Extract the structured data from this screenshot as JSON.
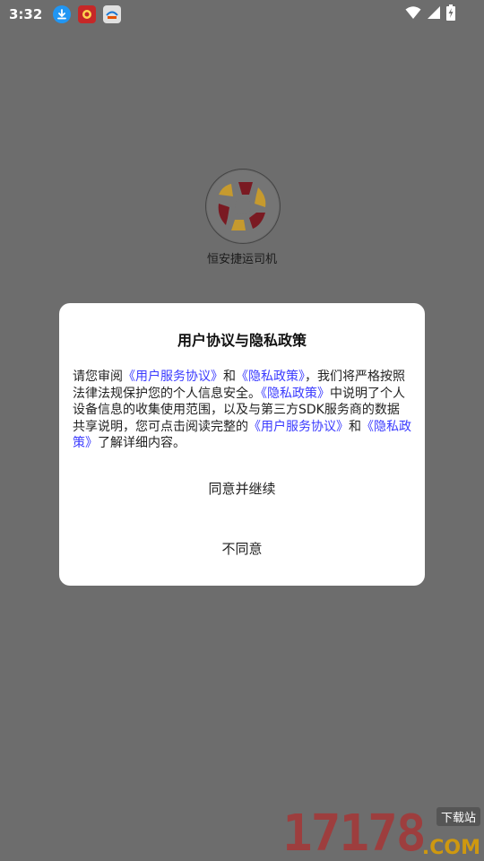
{
  "status_bar": {
    "time": "3:32",
    "icons": [
      "download-icon",
      "app-notification-icon",
      "app-notification-icon-2"
    ],
    "right_icons": [
      "wifi-icon",
      "signal-icon",
      "battery-charging-icon"
    ]
  },
  "splash": {
    "app_name": "恒安捷运司机"
  },
  "dialog": {
    "title": "用户协议与隐私政策",
    "body": {
      "p1": "请您审阅",
      "link_user_agreement": "《用户服务协议》",
      "p2": "和",
      "link_privacy_policy": "《隐私政策》",
      "p3": "，我们将严格按照法律法规保护您的个人信息安全。",
      "link_privacy_policy_2": "《隐私政策》",
      "p4": "中说明了个人设备信息的收集使用范围，以及与第三方SDK服务商的数据共享说明，您可点击阅读完整的",
      "link_user_agreement_2": "《用户服务协议》",
      "p5": "和",
      "link_privacy_policy_3": "《隐私政策》",
      "p6": "了解详细内容。"
    },
    "agree_label": "同意并继续",
    "disagree_label": "不同意"
  },
  "watermark": {
    "digits": "17178",
    "suffix": ".COM",
    "tag": "下载站"
  },
  "colors": {
    "overlay": "#6d6d6d",
    "link": "#3b3bff",
    "dialog_bg": "#ffffff"
  }
}
